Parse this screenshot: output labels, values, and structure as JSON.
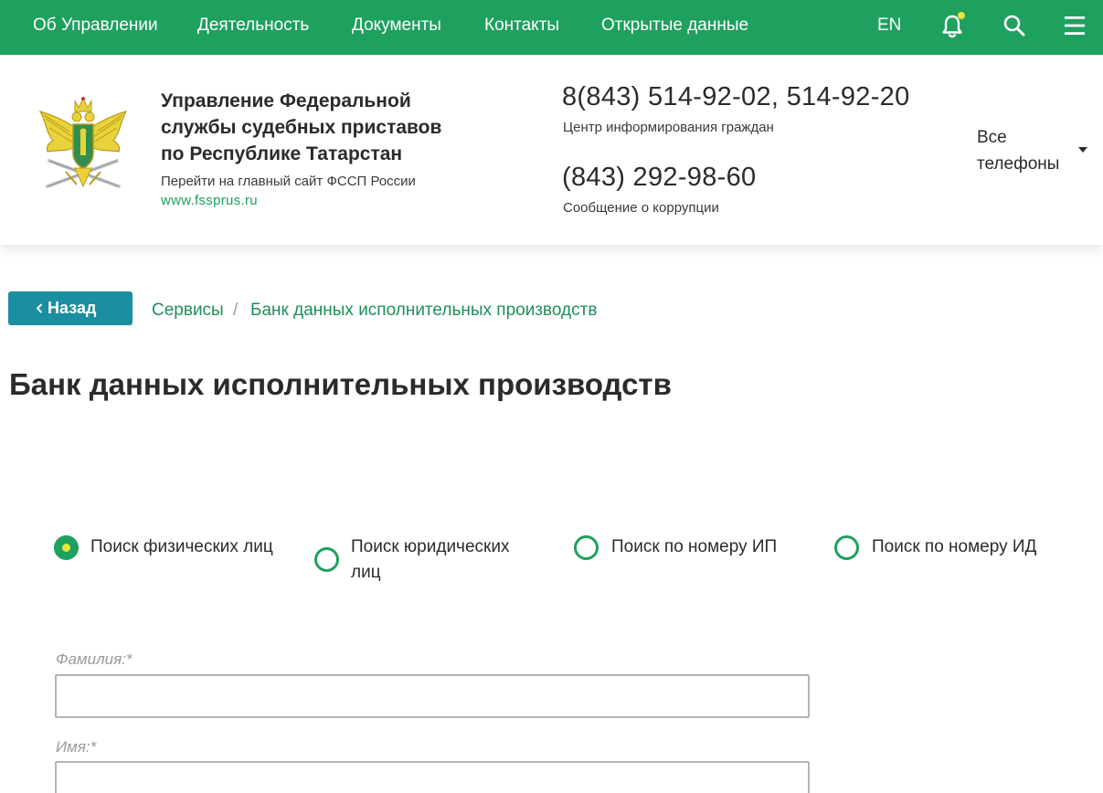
{
  "nav": {
    "items": [
      "Об Управлении",
      "Деятельность",
      "Документы",
      "Контакты",
      "Открытые данные"
    ],
    "lang": "EN",
    "icons": [
      "bell-icon",
      "search-icon",
      "menu-icon"
    ],
    "colors": {
      "bar": "#1ea05f",
      "notification_dot": "#e8e43c"
    }
  },
  "header": {
    "org_title_lines": [
      "Управление Федеральной",
      "службы судебных приставов",
      "по Республике Татарстан"
    ],
    "goto_main": "Перейти на главный сайт ФССП России",
    "site_link": "www.fssprus.ru",
    "phone1": "8(843) 514-92-02, 514-92-20",
    "phone1_caption": "Центр информирования граждан",
    "phone2": "(843) 292-98-60",
    "phone2_caption": "Сообщение о коррупции",
    "all_phones": "Все телефоны"
  },
  "breadcrumb": {
    "back_label": "Назад",
    "items": [
      "Сервисы",
      "Банк данных исполнительных производств"
    ],
    "separator": "/",
    "colors": {
      "back_button": "#1a8fa0",
      "link": "#1e8f5a"
    }
  },
  "page": {
    "title": "Банк данных исполнительных производств"
  },
  "search_modes": {
    "options": [
      "Поиск физических лиц",
      "Поиск юридических лиц",
      "Поиск по номеру ИП",
      "Поиск по номеру ИД"
    ],
    "selected": "Поиск физических лиц"
  },
  "form": {
    "lastname_label": "Фамилия:*",
    "lastname_value": "",
    "firstname_label": "Имя:*",
    "firstname_value": ""
  }
}
